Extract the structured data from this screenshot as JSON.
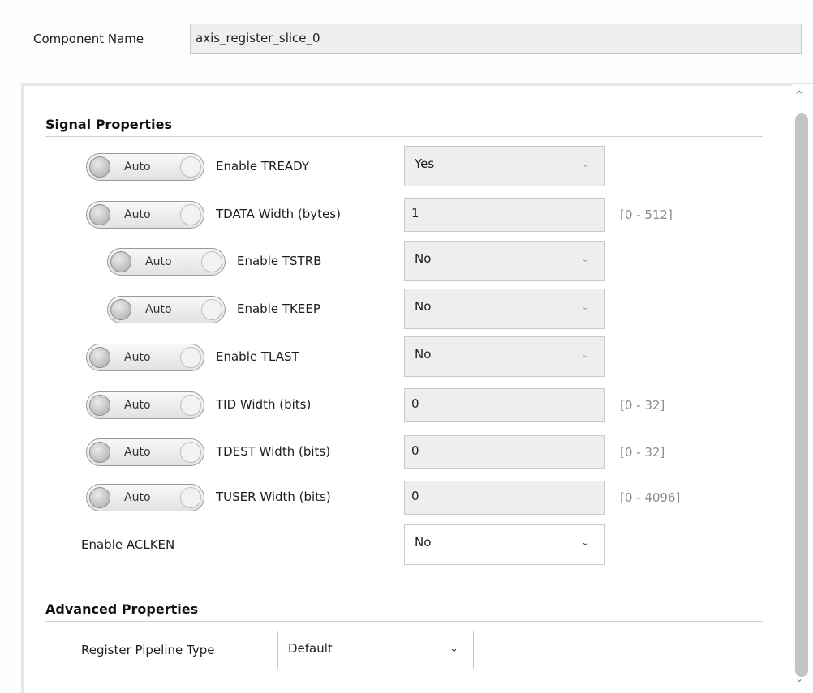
{
  "component": {
    "label": "Component Name",
    "value": "axis_register_slice_0"
  },
  "signal_properties": {
    "title": "Signal Properties",
    "rows": [
      {
        "toggle": "Auto",
        "label": "Enable TREADY",
        "value": "Yes",
        "kind": "select",
        "range": ""
      },
      {
        "toggle": "Auto",
        "label": "TDATA Width (bytes)",
        "value": "1",
        "kind": "text",
        "range": "[0 - 512]"
      },
      {
        "toggle": "Auto",
        "label": "Enable TSTRB",
        "value": "No",
        "kind": "select",
        "range": ""
      },
      {
        "toggle": "Auto",
        "label": "Enable TKEEP",
        "value": "No",
        "kind": "select",
        "range": ""
      },
      {
        "toggle": "Auto",
        "label": "Enable TLAST",
        "value": "No",
        "kind": "select",
        "range": ""
      },
      {
        "toggle": "Auto",
        "label": "TID Width (bits)",
        "value": "0",
        "kind": "text",
        "range": "[0 - 32]"
      },
      {
        "toggle": "Auto",
        "label": "TDEST Width (bits)",
        "value": "0",
        "kind": "text",
        "range": "[0 - 32]"
      },
      {
        "toggle": "Auto",
        "label": "TUSER Width (bits)",
        "value": "0",
        "kind": "text",
        "range": "[0 - 4096]"
      }
    ],
    "aclken": {
      "label": "Enable ACLKEN",
      "value": "No"
    }
  },
  "advanced_properties": {
    "title": "Advanced Properties",
    "pipeline": {
      "label": "Register Pipeline Type",
      "value": "Default"
    }
  },
  "icons": {
    "dropdown": "chevron-down-icon",
    "scroll_up": "scroll-up-arrow-icon",
    "scroll_down": "scroll-down-arrow-icon"
  },
  "glyphs": {
    "chevron": "⌄",
    "up": "^",
    "down": "⌄"
  },
  "colors": {
    "disabled_field": "#eeeeee",
    "range_text": "#8a8a8a",
    "section_rule": "#cfcfcf"
  }
}
